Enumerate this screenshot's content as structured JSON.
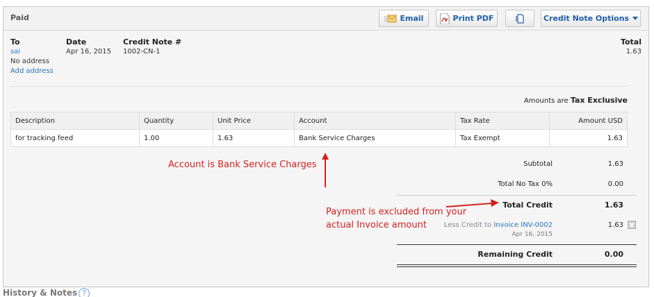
{
  "header": {
    "status": "Paid",
    "email_label": "Email",
    "print_pdf_label": "Print PDF",
    "options_label": "Credit Note Options"
  },
  "details": {
    "to_label": "To",
    "to_name": "sai",
    "address": "No address",
    "add_address": "Add address",
    "date_label": "Date",
    "date_value": "Apr 16, 2015",
    "number_label": "Credit Note #",
    "number_value": "1002-CN-1",
    "total_label": "Total",
    "total_value": "1.63"
  },
  "amounts_are": {
    "prefix": "Amounts are",
    "value": "Tax Exclusive"
  },
  "table": {
    "columns": [
      "Description",
      "Quantity",
      "Unit Price",
      "Account",
      "Tax Rate",
      "Amount USD"
    ],
    "rows": [
      [
        "for tracking feed",
        "1.00",
        "1.63",
        "Bank Service Charges",
        "Tax Exempt",
        "1.63"
      ]
    ]
  },
  "summary": {
    "subtotal_label": "Subtotal",
    "subtotal_value": "1.63",
    "tax_label": "Total No Tax 0%",
    "tax_value": "0.00",
    "total_credit_label": "Total Credit",
    "total_credit_value": "1.63",
    "less_credit_prefix": "Less Credit to",
    "less_credit_link": "Invoice INV-0002",
    "less_credit_date": "Apr 16, 2015",
    "less_credit_value": "1.63",
    "remaining_label": "Remaining Credit",
    "remaining_value": "0.00"
  },
  "annotations": {
    "account_note": "Account is Bank Service Charges",
    "payment_note_line1": "Payment is excluded from your",
    "payment_note_line2": "actual Invoice amount"
  },
  "footer": {
    "history_label": "History & Notes",
    "help_glyph": "?"
  },
  "colors": {
    "link": "#2a78c2",
    "annotation": "#d62020"
  }
}
